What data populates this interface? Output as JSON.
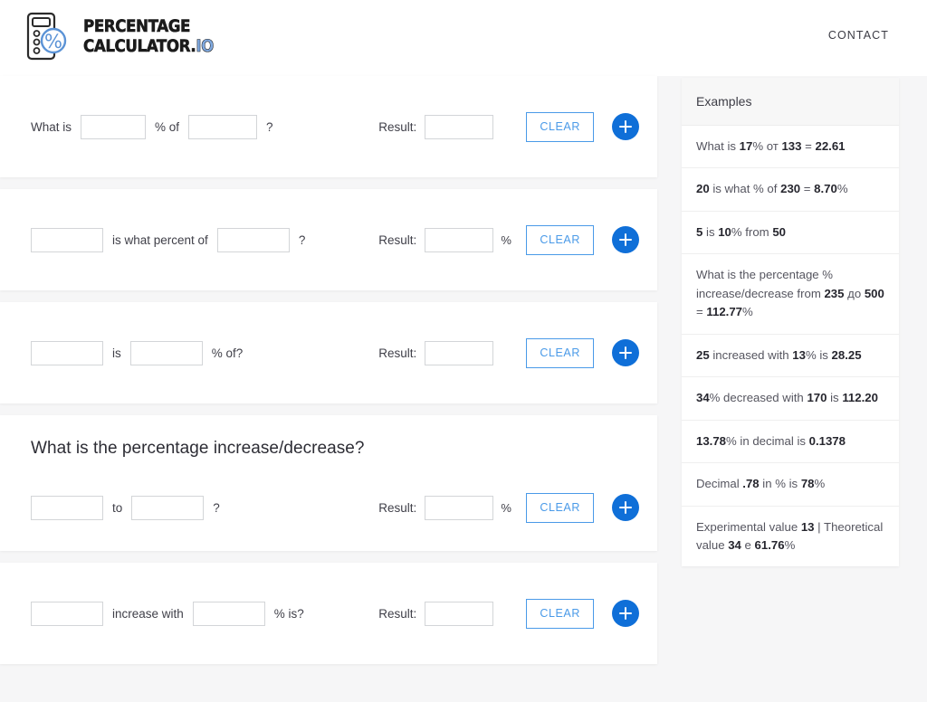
{
  "header": {
    "logo_line1": "PERCENTAGE",
    "logo_line2": "CALCULATOR.",
    "logo_suffix": "IO",
    "logo_icon": "calculator-percent-icon",
    "contact_label": "CONTACT"
  },
  "colors": {
    "accent_blue": "#0f6fd8",
    "clear_blue": "#4a9ae8",
    "logo_io_blue": "#7fa9e0",
    "page_bg": "#f6f6f7",
    "card_bg": "#ffffff",
    "panel_head_bg": "#f7f7f7",
    "field_border": "#d3d5d8"
  },
  "calculators": [
    {
      "id": "what-is-percent-of",
      "title": "",
      "prefix": "What is",
      "mid": "% of",
      "suffix": "?",
      "input1_value": "",
      "input2_value": "",
      "result_label": "Result:",
      "result_value": "",
      "result_suffix": "",
      "clear_label": "CLEAR",
      "add_label": "+"
    },
    {
      "id": "is-what-percent-of",
      "title": "",
      "prefix": "",
      "mid": "is what percent of",
      "suffix": "?",
      "input1_value": "",
      "input2_value": "",
      "result_label": "Result:",
      "result_value": "",
      "result_suffix": "%",
      "clear_label": "CLEAR",
      "add_label": "+"
    },
    {
      "id": "is-percent-of-what",
      "title": "",
      "prefix": "",
      "mid": "is",
      "suffix": "% of?",
      "input1_value": "",
      "input2_value": "",
      "result_label": "Result:",
      "result_value": "",
      "result_suffix": "",
      "clear_label": "CLEAR",
      "add_label": "+"
    },
    {
      "id": "percentage-increase-decrease",
      "title": "What is the percentage increase/decrease?",
      "prefix": "",
      "mid": "to",
      "suffix": "?",
      "input1_value": "",
      "input2_value": "",
      "result_label": "Result:",
      "result_value": "",
      "result_suffix": "%",
      "clear_label": "CLEAR",
      "add_label": "+"
    },
    {
      "id": "increase-with-percent",
      "title": "",
      "prefix": "",
      "mid": "increase with",
      "suffix": "% is?",
      "input1_value": "",
      "input2_value": "",
      "result_label": "Result:",
      "result_value": "",
      "result_suffix": "",
      "clear_label": "CLEAR",
      "add_label": "+"
    }
  ],
  "examples": {
    "title": "Examples",
    "items": [
      {
        "html": "What is <b>17</b>% от <b>133</b> = <b>22.61</b>"
      },
      {
        "html": "<b>20</b> is what % of <b>230</b> = <b>8.70</b>%"
      },
      {
        "html": "<b>5</b> is <b>10</b>% from <b>50</b>"
      },
      {
        "html": "What is the percentage % increase/decrease from <b>235</b> до <b>500</b> = <b>112.77</b>%"
      },
      {
        "html": "<b>25</b> increased with <b>13</b>% is <b>28.25</b>"
      },
      {
        "html": "<b>34</b>% decreased with <b>170</b> is <b>112.20</b>"
      },
      {
        "html": "<b>13.78</b>% in decimal is <b>0.1378</b>"
      },
      {
        "html": "Decimal <b>.78</b> in % is <b>78</b>%"
      },
      {
        "html": "Experimental value <b>13</b> | Theoretical value <b>34</b> е <b>61.76</b>%"
      }
    ]
  }
}
